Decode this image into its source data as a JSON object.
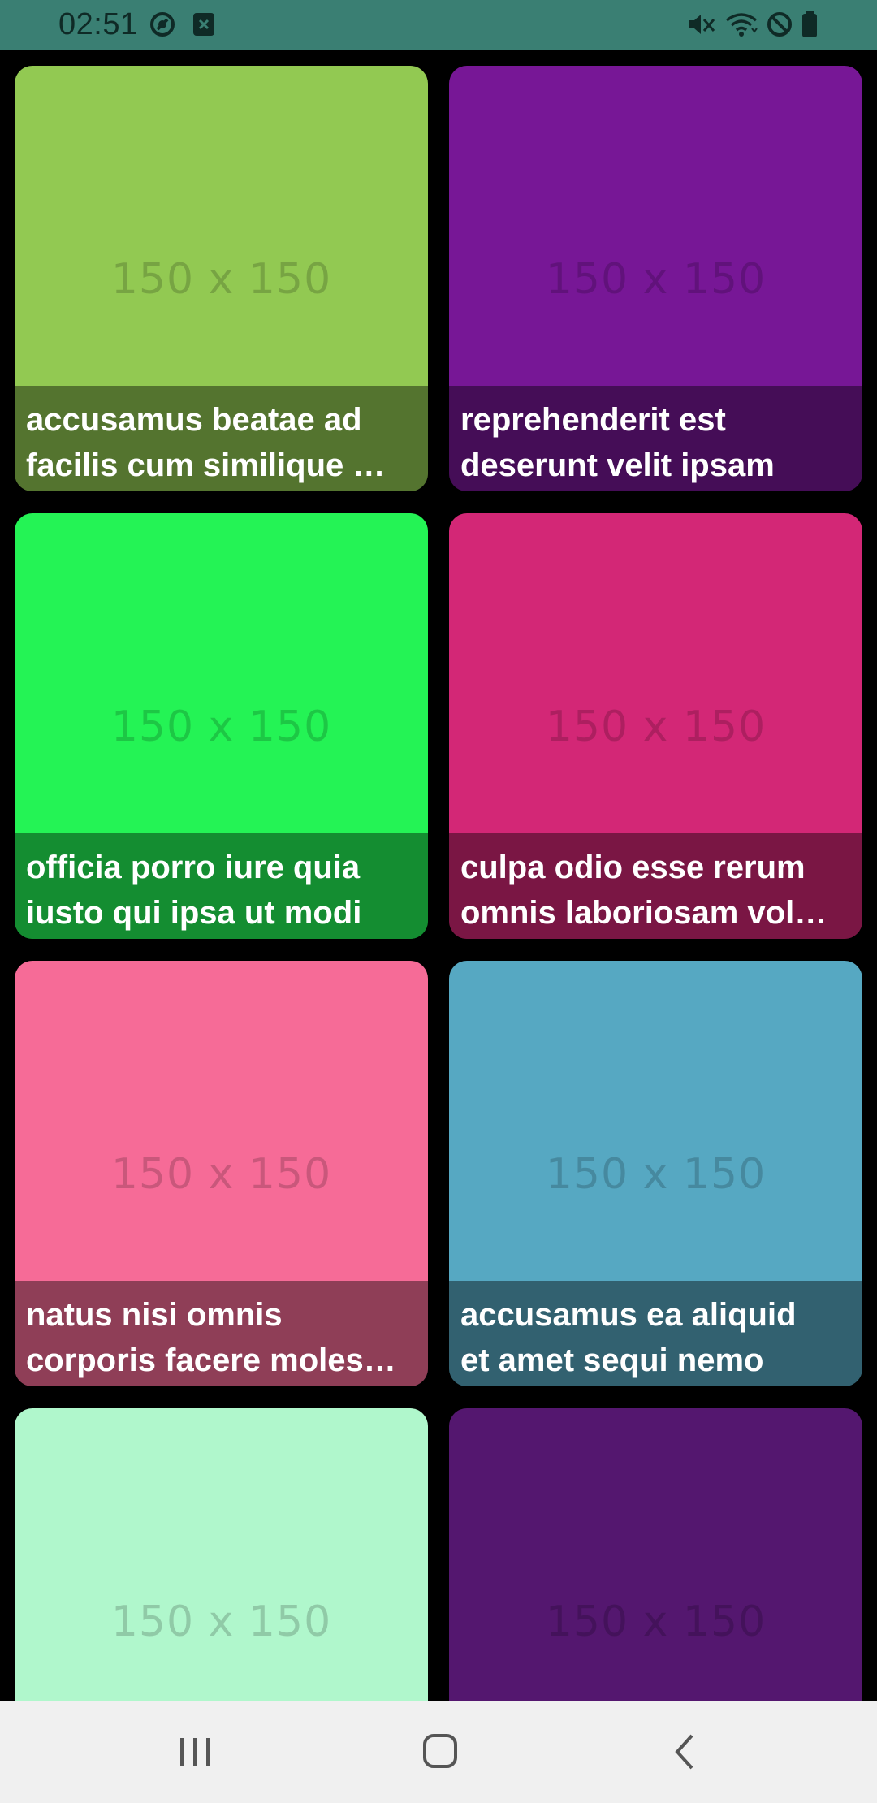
{
  "status_bar": {
    "time": "02:51",
    "left_icons": [
      "data-saver-icon",
      "no-sim-notification-icon"
    ],
    "right_icons": [
      "mute-icon",
      "wifi-icon",
      "do-not-disturb-icon",
      "battery-icon"
    ],
    "background": "#3a7f73"
  },
  "grid": {
    "placeholder_label": "150 x 150",
    "cards": [
      {
        "color": "#92c952",
        "title": "accusamus beatae ad facilis cum similique qui sunt",
        "line1": "accusamus beatae ad",
        "line2": "facilis cum similique …"
      },
      {
        "color": "#771796",
        "title": "reprehenderit est deserunt velit ipsam",
        "line1": "reprehenderit est",
        "line2": "deserunt velit ipsam"
      },
      {
        "color": "#24f355",
        "title": "officia porro iure quia iusto qui ipsa ut modi",
        "line1": "officia porro iure quia",
        "line2": "iusto qui ipsa ut modi"
      },
      {
        "color": "#d32776",
        "title": "culpa odio esse rerum omnis laboriosam voluptate repudiandae",
        "line1": "culpa odio esse rerum",
        "line2": "omnis laboriosam vol…"
      },
      {
        "color": "#f66b97",
        "title": "natus nisi omnis corporis facere molestiae rerum in",
        "line1": "natus nisi omnis",
        "line2": "corporis facere moles…"
      },
      {
        "color": "#56a8c2",
        "title": "accusamus ea aliquid et amet sequi nemo",
        "line1": "accusamus ea aliquid",
        "line2": "et amet sequi nemo"
      },
      {
        "color": "#b0f7cc",
        "title": "",
        "line1": "",
        "line2": ""
      },
      {
        "color": "#54176f",
        "title": "",
        "line1": "",
        "line2": ""
      }
    ]
  },
  "nav_bar": {
    "buttons": [
      "recent-apps-icon",
      "home-icon",
      "back-icon"
    ],
    "background": "#f0f0f0"
  }
}
